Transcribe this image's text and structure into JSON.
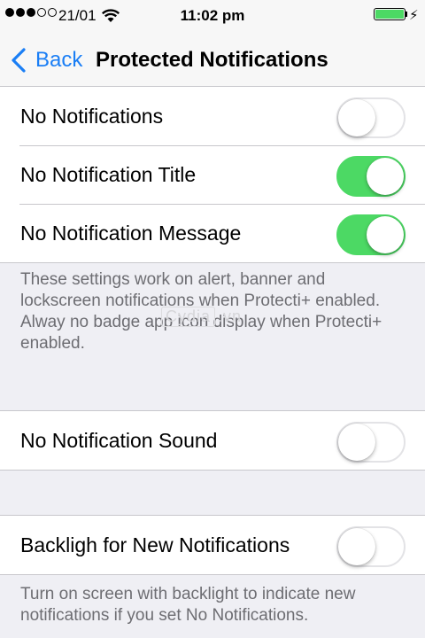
{
  "status_bar": {
    "signal_dots": [
      true,
      true,
      true,
      false,
      false
    ],
    "carrier": "21/01",
    "time": "11:02 pm",
    "battery_level": 1.0,
    "battery_color": "#4cd964"
  },
  "nav": {
    "back_label": "Back",
    "title": "Protected Notifications",
    "accent_color": "#1a7ef5"
  },
  "group1": {
    "rows": [
      {
        "label": "No Notifications",
        "on": false
      },
      {
        "label": "No Notification Title",
        "on": true
      },
      {
        "label": "No Notification Message",
        "on": true
      }
    ],
    "footer": [
      "These settings work on alert, banner and lockscreen notifications when Protecti+ enabled.",
      "Alway no badge app icon display when Protecti+ enabled."
    ]
  },
  "watermark": {
    "brand": "Cydia",
    "suffix": ".vn"
  },
  "group2": {
    "rows": [
      {
        "label": "No Notification Sound",
        "on": false
      }
    ]
  },
  "group3": {
    "rows": [
      {
        "label": "Backligh for New Notifications",
        "on": false
      }
    ],
    "footer": [
      "Turn on screen with backlight to indicate new notifications if you set No Notifications."
    ]
  },
  "colors": {
    "toggle_on": "#4cd964",
    "background": "#efeff4",
    "footer_text": "#6d6d72"
  }
}
